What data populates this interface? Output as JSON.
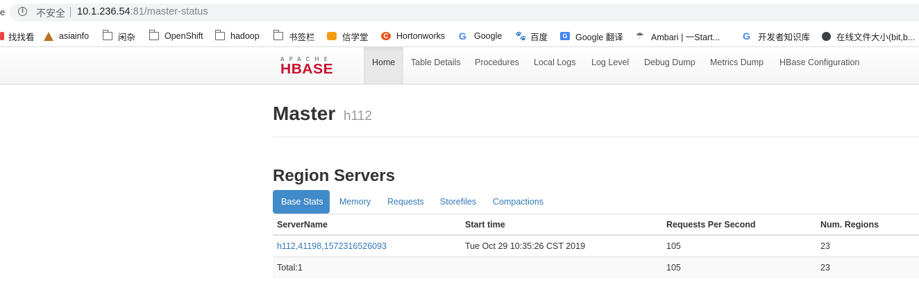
{
  "browser": {
    "insecure_label": "不安全",
    "url_host": "10.1.236.54",
    "url_rest": ":81/master-status",
    "left_fragment": "e"
  },
  "bookmarks": [
    {
      "label": "找找看",
      "icon": "red-mark-icon"
    },
    {
      "label": "asiainfo",
      "icon": "asiainfo-logo-icon"
    },
    {
      "label": "闲杂",
      "icon": "folder-icon"
    },
    {
      "label": "OpenShift",
      "icon": "folder-icon"
    },
    {
      "label": "hadoop",
      "icon": "folder-icon"
    },
    {
      "label": "书签栏",
      "icon": "folder-icon"
    },
    {
      "label": "信学堂",
      "icon": "cloud-icon"
    },
    {
      "label": "Hortonworks",
      "icon": "hortonworks-icon",
      "glyph": "C"
    },
    {
      "label": "Google",
      "icon": "google-icon",
      "glyph": "G"
    },
    {
      "label": "百度",
      "icon": "baidu-paw-icon",
      "glyph": "🐾"
    },
    {
      "label": "Google 翻译",
      "icon": "google-translate-icon",
      "glyph": "G"
    },
    {
      "label": "Ambari | 一Start...",
      "icon": "ambari-icon",
      "glyph": "☂"
    },
    {
      "label": "开发者知识库",
      "icon": "google-icon",
      "glyph": "G"
    },
    {
      "label": "在线文件大小(bit,b...",
      "icon": "globe-icon"
    }
  ],
  "logo": {
    "top": "APACHE",
    "main": "HBASE"
  },
  "nav": [
    "Home",
    "Table Details",
    "Procedures",
    "Local Logs",
    "Log Level",
    "Debug Dump",
    "Metrics Dump",
    "HBase Configuration"
  ],
  "master": {
    "title": "Master",
    "host": "h112"
  },
  "region_servers": {
    "title": "Region Servers",
    "tabs": [
      "Base Stats",
      "Memory",
      "Requests",
      "Storefiles",
      "Compactions"
    ],
    "columns": [
      "ServerName",
      "Start time",
      "Requests Per Second",
      "Num. Regions"
    ],
    "rows": [
      {
        "server": "h112,41198,1572316526093",
        "start": "Tue Oct 29 10:35:26 CST 2019",
        "rps": "105",
        "regions": "23"
      }
    ],
    "total": {
      "label": "Total:1",
      "start": "",
      "rps": "105",
      "regions": "23"
    }
  }
}
